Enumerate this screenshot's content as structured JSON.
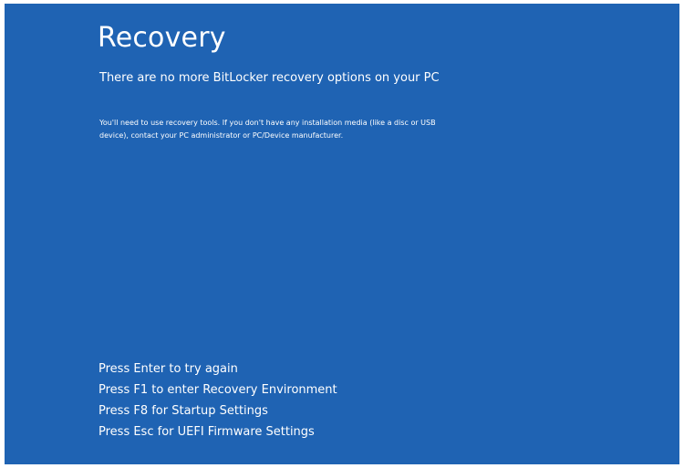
{
  "screen": {
    "background_color": "#1f63b3",
    "title": "Recovery",
    "subtitle": "There are no more BitLocker recovery options on your PC",
    "details": "You'll need to use recovery tools. If you don't have any installation media (like a disc or USB\ndevice), contact your PC administrator or PC/Device manufacturer.",
    "options": [
      "Press Enter to try again",
      "Press F1 to enter Recovery Environment",
      "Press F8 for Startup Settings",
      "Press Esc for UEFI Firmware Settings"
    ]
  }
}
